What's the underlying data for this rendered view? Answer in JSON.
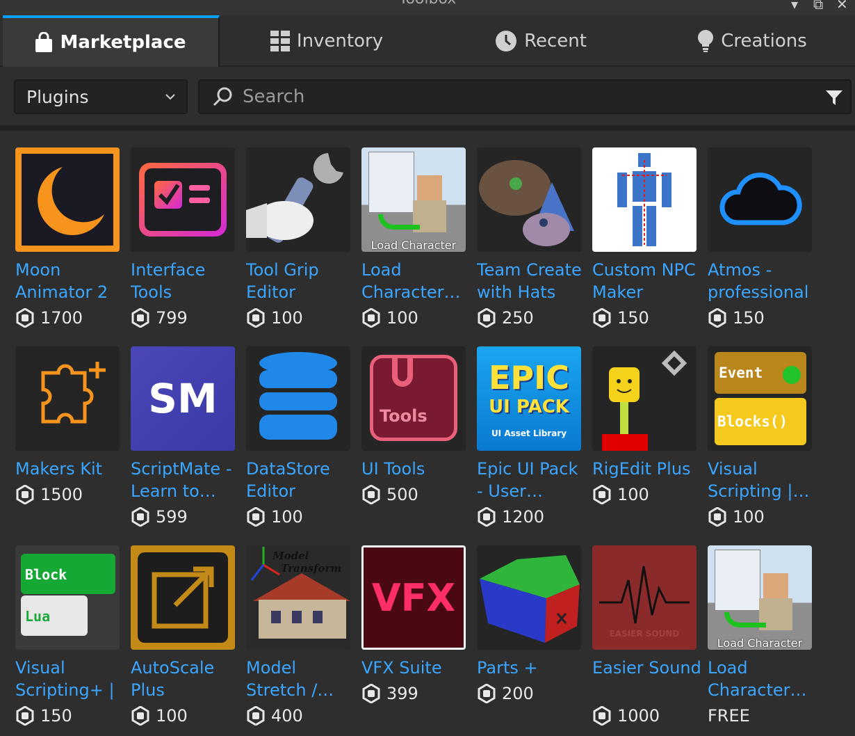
{
  "window": {
    "title": "Toolbox"
  },
  "tabs": [
    {
      "label": "Marketplace",
      "icon": "shopping-bag-icon",
      "active": true
    },
    {
      "label": "Inventory",
      "icon": "grid-icon",
      "active": false
    },
    {
      "label": "Recent",
      "icon": "clock-icon",
      "active": false
    },
    {
      "label": "Creations",
      "icon": "lightbulb-icon",
      "active": false
    }
  ],
  "search": {
    "category": "Plugins",
    "placeholder": "Search"
  },
  "colors": {
    "accent": "#00a2ff",
    "link": "#3aa6ff",
    "background": "#2e2e2e"
  },
  "items": [
    {
      "name": "Moon Animator 2",
      "price": "1700"
    },
    {
      "name": "Interface Tools",
      "price": "799"
    },
    {
      "name": "Tool Grip Editor",
      "price": "100"
    },
    {
      "name": "Load Character…",
      "price": "100"
    },
    {
      "name": "Team Create with Hats",
      "price": "250"
    },
    {
      "name": "Custom NPC Maker",
      "price": "150"
    },
    {
      "name": "Atmos - professional",
      "price": "150"
    },
    {
      "name": "Makers Kit",
      "price": "1500"
    },
    {
      "name": "ScriptMate - Learn to…",
      "price": "599"
    },
    {
      "name": "DataStore Editor",
      "price": "100"
    },
    {
      "name": "UI Tools",
      "price": "500"
    },
    {
      "name": "Epic UI Pack - User…",
      "price": "1200"
    },
    {
      "name": "RigEdit Plus",
      "price": "100"
    },
    {
      "name": "Visual Scripting |…",
      "price": "100"
    },
    {
      "name": "Visual Scripting+ |",
      "price": "150"
    },
    {
      "name": "AutoScale Plus",
      "price": "100"
    },
    {
      "name": "Model Stretch /…",
      "price": "400"
    },
    {
      "name": "VFX Suite",
      "price": "399"
    },
    {
      "name": "Parts +",
      "price": "200"
    },
    {
      "name": "Easier Sound",
      "price": "1000"
    },
    {
      "name": "Load Character…",
      "price": "FREE"
    }
  ],
  "thumb_text": {
    "load_character": "Load Character",
    "sm": "SM",
    "tools": "Tools",
    "epic": "EPIC",
    "ui_pack": "UI PACK",
    "ui_asset_library": "UI Asset Library",
    "event": "Event",
    "blocks": "Blocks()",
    "block": "Block",
    "lua": "Lua",
    "model": "Model",
    "transform": "Transform",
    "vfx": "VFX",
    "easier_sound": "EASIER SOUND"
  }
}
